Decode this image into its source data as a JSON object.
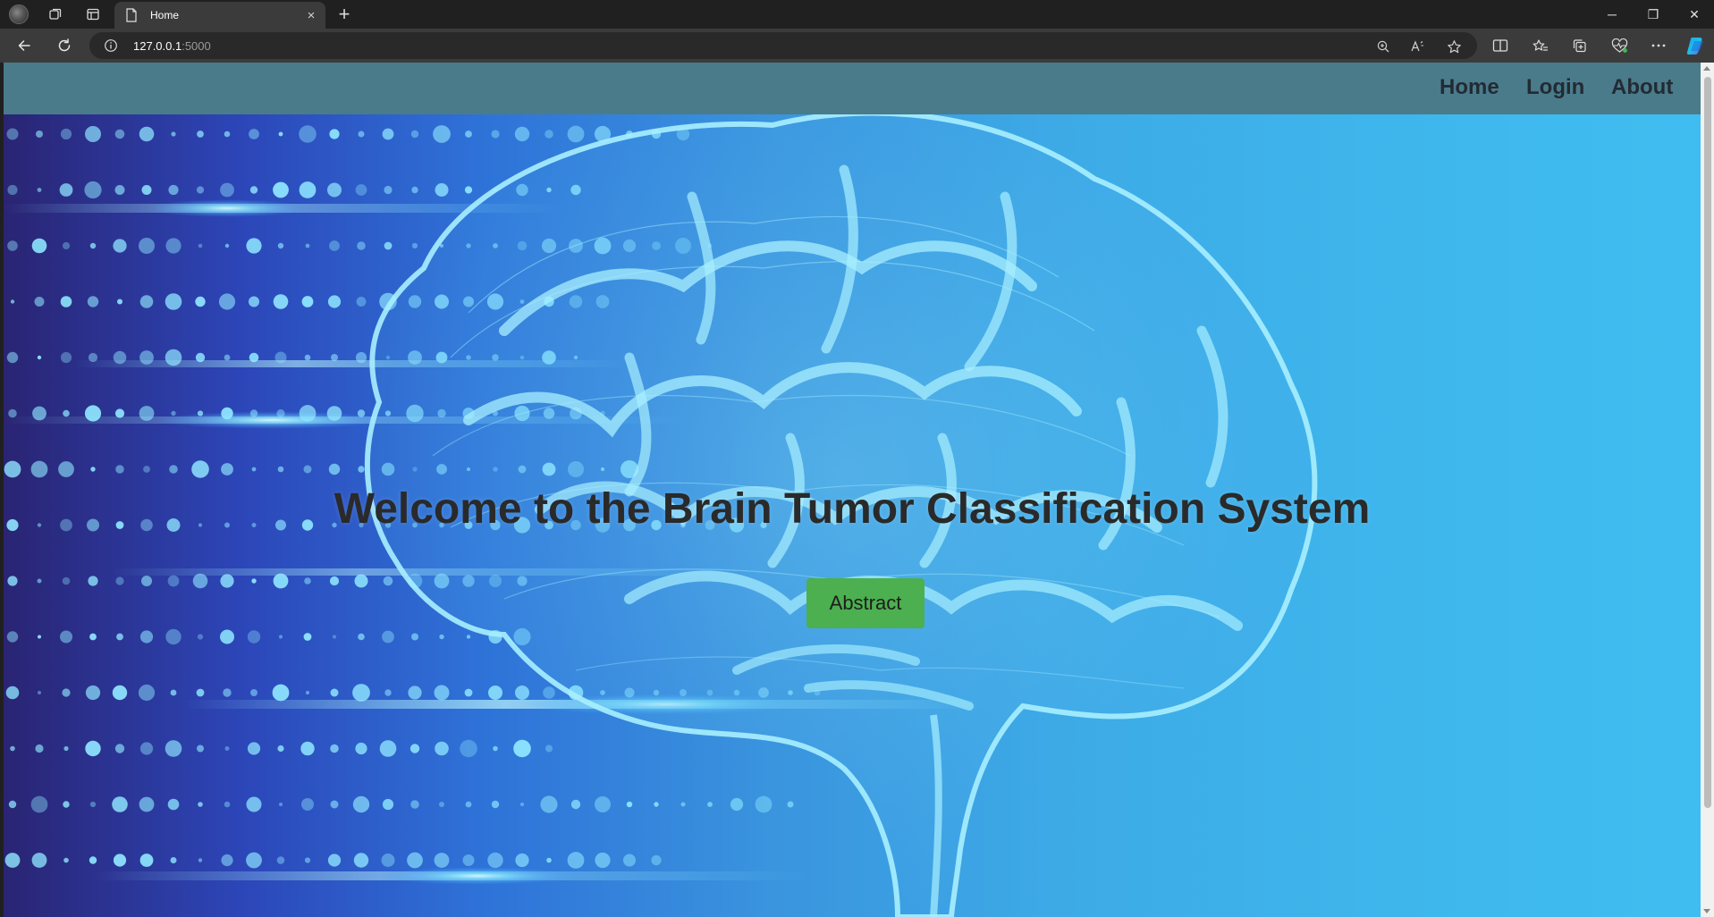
{
  "browser": {
    "tab_title": "Home",
    "tab_close": "×",
    "new_tab": "+",
    "url_host": "127.0.0.1",
    "url_port": ":5000",
    "window_min": "─",
    "window_max": "❐",
    "window_close": "✕",
    "icons": {
      "back": "arrow-left-icon",
      "reload": "refresh-icon",
      "info": "info-icon",
      "zoom": "zoom-icon",
      "read_aloud": "read-aloud-icon",
      "favorite": "star-icon",
      "split": "split-screen-icon",
      "favorites": "favorites-icon",
      "collections": "collections-icon",
      "health": "browser-essentials-icon",
      "more": "more-icon",
      "copilot": "copilot-icon"
    }
  },
  "site": {
    "nav": {
      "home": "Home",
      "login": "Login",
      "about": "About"
    },
    "hero": {
      "title": "Welcome to the Brain Tumor Classification System",
      "button": "Abstract"
    },
    "colors": {
      "navbar": "#4a7b8b",
      "button": "#4caf50",
      "text": "#2a2a2a"
    }
  }
}
